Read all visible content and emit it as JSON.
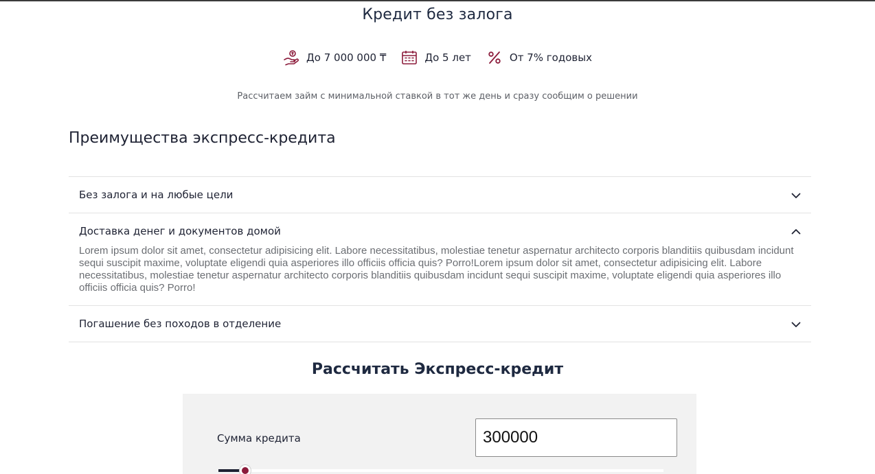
{
  "hero": {
    "title": "Кредит без залога",
    "features": [
      {
        "icon": "hand-money-icon",
        "label": "До 7 000 000 ₸"
      },
      {
        "icon": "calendar-icon",
        "label": "До 5 лет"
      },
      {
        "icon": "percent-icon",
        "label": "От 7% годовых"
      }
    ],
    "subtitle": "Рассчитаем займ с минимальной ставкой в тот же день и сразу сообщим о решении"
  },
  "advantages": {
    "title": "Преимущества экспресс-кредита",
    "items": [
      {
        "label": "Без залога и на любые цели",
        "expanded": false
      },
      {
        "label": "Доставка денег и документов домой",
        "expanded": true,
        "body": "Lorem ipsum dolor sit amet, consectetur adipisicing elit. Labore necessitatibus, molestiae tenetur aspernatur architecto corporis blanditiis quibusdam incidunt sequi suscipit maxime, voluptate eligendi quia asperiores illo officiis officia quis? Porro!Lorem ipsum dolor sit amet, consectetur adipisicing elit. Labore necessitatibus, molestiae tenetur aspernatur architecto corporis blanditiis quibusdam incidunt sequi suscipit maxime, voluptate eligendi quia asperiores illo officiis officia quis? Porro!"
      },
      {
        "label": "Погашение без походов в отделение",
        "expanded": false
      }
    ]
  },
  "calculator": {
    "title": "Рассчитать Экспресс-кредит",
    "amount_label": "Сумма кредита",
    "amount_value": "300000",
    "slider_fraction": 0.06
  },
  "colors": {
    "accent": "#8b1a3a",
    "text": "#1e2233",
    "panel": "#f2f2f2"
  }
}
